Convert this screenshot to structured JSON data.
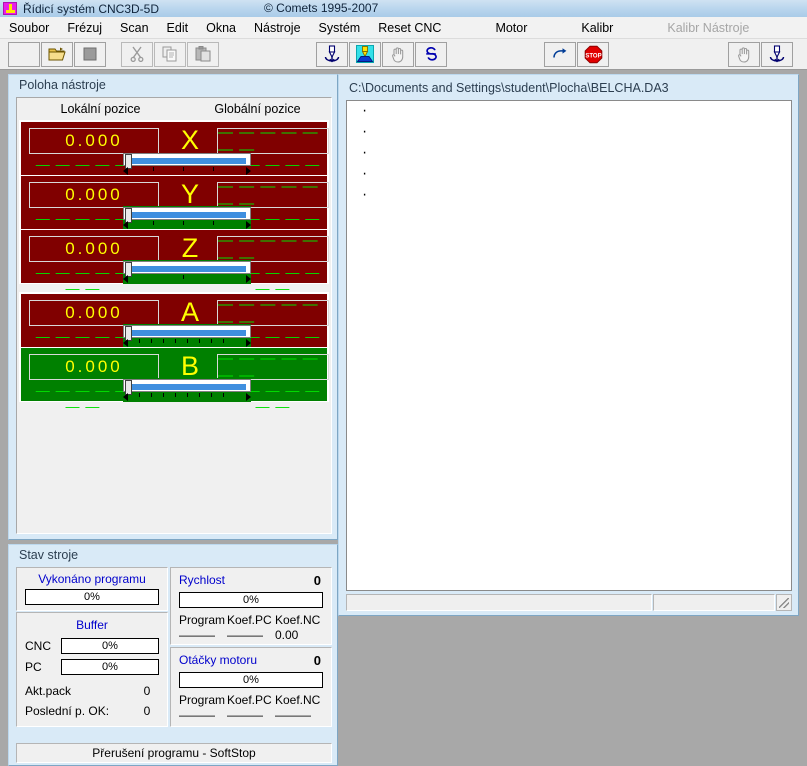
{
  "titlebar": {
    "icon": "cnc-app-icon",
    "title": "Řídicí systém CNC3D-5D",
    "copyright": "© Comets 1995-2007"
  },
  "menubar": {
    "items": [
      {
        "label": "Soubor",
        "disabled": false
      },
      {
        "label": "Frézuj",
        "disabled": false
      },
      {
        "label": "Scan",
        "disabled": false
      },
      {
        "label": "Edit",
        "disabled": false
      },
      {
        "label": "Okna",
        "disabled": false
      },
      {
        "label": "Nástroje",
        "disabled": false
      },
      {
        "label": "Systém",
        "disabled": false
      },
      {
        "label": "Reset CNC",
        "disabled": false
      },
      {
        "label": "Motor",
        "disabled": false
      },
      {
        "label": "Kalibr",
        "disabled": false
      },
      {
        "label": "Kalibr Nástroje",
        "disabled": true
      }
    ]
  },
  "toolbar": {
    "buttons": [
      {
        "name": "new-file-button",
        "icon": "blank-icon"
      },
      {
        "name": "open-file-button",
        "icon": "open-folder-icon"
      },
      {
        "name": "save-file-button",
        "icon": "save-icon"
      },
      {
        "name": "cut-button",
        "icon": "scissors-icon"
      },
      {
        "name": "copy-button",
        "icon": "copy-icon"
      },
      {
        "name": "paste-button",
        "icon": "paste-icon"
      },
      {
        "name": "tool-down-button",
        "icon": "drill-down-icon"
      },
      {
        "name": "tool-measure-button",
        "icon": "tool-measure-icon"
      },
      {
        "name": "hand-move-button",
        "icon": "hand-icon"
      },
      {
        "name": "spindle-button",
        "icon": "spiral-s-icon"
      },
      {
        "name": "run-button",
        "icon": "redo-arrow-icon"
      },
      {
        "name": "stop-button",
        "icon": "stop-sign-icon"
      },
      {
        "name": "hand-jog-button",
        "icon": "hand-icon"
      },
      {
        "name": "tool-ref-button",
        "icon": "drill-down-icon"
      }
    ]
  },
  "position_panel": {
    "title": "Poloha nástroje",
    "col_local": "Lokální pozice",
    "col_global": "Globální pozice",
    "dash_value": "— — — — — — —",
    "axes": [
      {
        "label": "X",
        "local": "0.000",
        "global": "— — — — — — —",
        "row_bg": "#800000",
        "slider_bg": "#800000",
        "ticks": 5
      },
      {
        "label": "Y",
        "local": "0.000",
        "global": "— — — — — — —",
        "row_bg": "#800000",
        "slider_bg": "#008000",
        "ticks": 5
      },
      {
        "label": "Z",
        "local": "0.000",
        "global": "— — — — — — —",
        "row_bg": "#800000",
        "slider_bg": "#008000",
        "ticks": 5
      },
      {
        "label": "A",
        "local": "0.000",
        "global": "— — — — — — —",
        "row_bg": "#800000",
        "slider_bg": "#008000",
        "ticks": 11
      },
      {
        "label": "B",
        "local": "0.000",
        "global": "— — — — — — —",
        "row_bg": "#008000",
        "slider_bg": "#008000",
        "ticks": 11
      }
    ],
    "colors": {
      "value_text": "#ffff00",
      "dash_text": "#00e000",
      "red_bg": "#800000",
      "green_bg": "#008000",
      "slider_fill": "#3f8fdf"
    }
  },
  "status_panel": {
    "title": "Stav stroje",
    "program_done_label": "Vykonáno programu",
    "program_done_value": "0%",
    "buffer_label": "Buffer",
    "buffer_cnc_label": "CNC",
    "buffer_cnc_value": "0%",
    "buffer_pc_label": "PC",
    "buffer_pc_value": "0%",
    "akt_pack_label": "Akt.pack",
    "akt_pack_value": "0",
    "last_ok_label": "Poslední p. OK:",
    "last_ok_value": "0",
    "speed": {
      "label": "Rychlost",
      "value": "0",
      "progress": "0%",
      "col_program": "Program",
      "col_koef_pc": "Koef.PC",
      "col_koef_nc": "Koef.NC",
      "val_program": "———",
      "val_koef_pc": "———",
      "val_koef_nc": "0.00"
    },
    "spindle": {
      "label": "Otáčky motoru",
      "value": "0",
      "progress": "0%",
      "col_program": "Program",
      "col_koef_pc": "Koef.PC",
      "col_koef_nc": "Koef.NC",
      "val_program": "———",
      "val_koef_pc": "———",
      "val_koef_nc": "———"
    },
    "bottom_status": "Přerušení programu - SoftStop"
  },
  "editor": {
    "path": "C:\\Documents and Settings\\student\\Plocha\\BELCHA.DA3",
    "lines": [
      "·",
      "·",
      "·",
      "·",
      "·"
    ],
    "statusbar": {
      "pane1": "",
      "pane2": "",
      "grip": "resize-grip"
    }
  }
}
